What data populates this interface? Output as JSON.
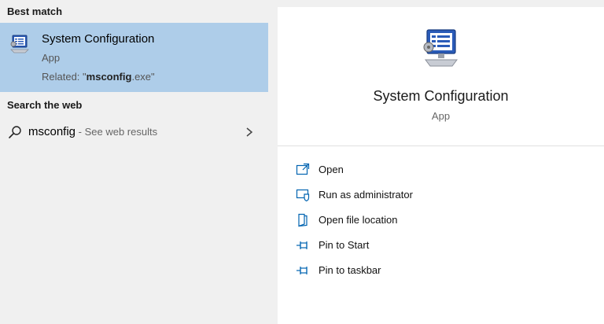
{
  "left": {
    "best_match_header": "Best match",
    "best_match": {
      "title": "System Configuration",
      "type": "App",
      "related_prefix": "Related: \"",
      "related_bold": "msconfig",
      "related_suffix": ".exe\""
    },
    "web_header": "Search the web",
    "web_result": {
      "query": "msconfig",
      "sub": " - See web results"
    }
  },
  "right": {
    "title": "System Configuration",
    "type": "App",
    "actions": [
      {
        "label": "Open",
        "icon": "open-icon"
      },
      {
        "label": "Run as administrator",
        "icon": "shield-run-icon"
      },
      {
        "label": "Open file location",
        "icon": "file-location-icon"
      },
      {
        "label": "Pin to Start",
        "icon": "pin-icon"
      },
      {
        "label": "Pin to taskbar",
        "icon": "pin-icon"
      }
    ]
  },
  "colors": {
    "selection": "#aecde9",
    "accent_icon": "#0063b1",
    "panel": "#ffffff",
    "background": "#f0f0f0"
  }
}
